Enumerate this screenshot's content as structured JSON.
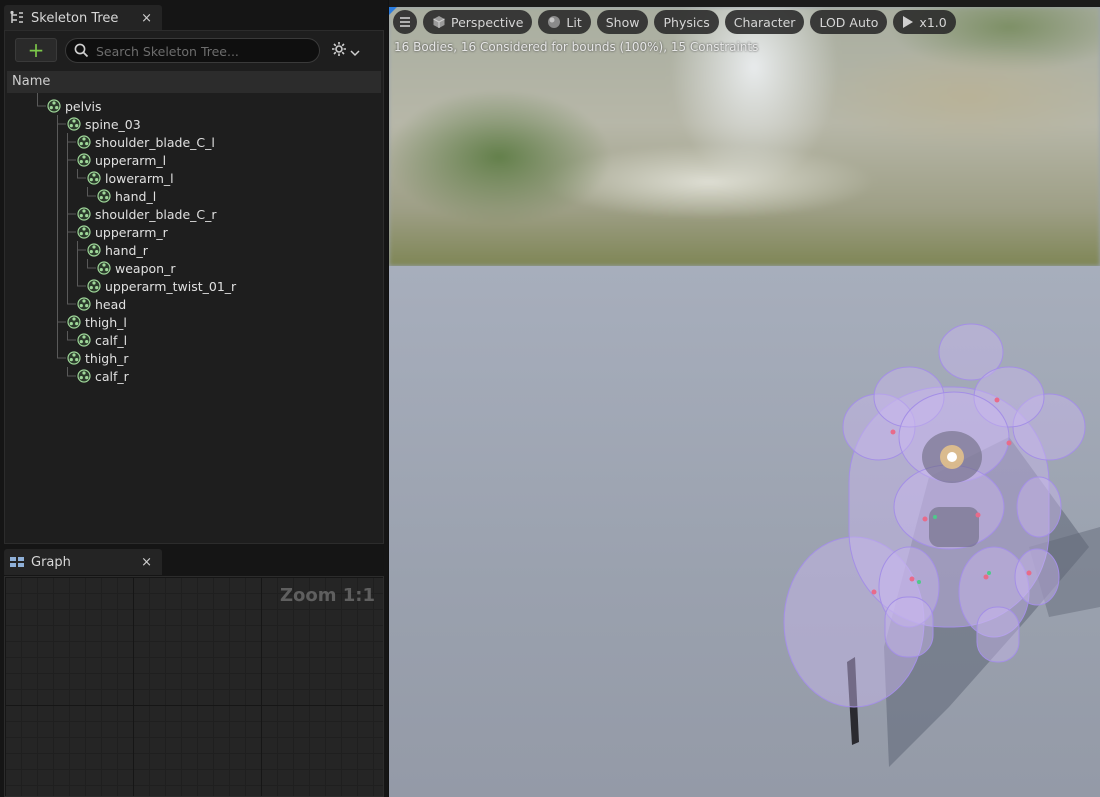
{
  "skeleton_panel": {
    "tab_title": "Skeleton Tree",
    "close_glyph": "×",
    "add_glyph": "+",
    "search_placeholder": "Search Skeleton Tree...",
    "column_header": "Name",
    "bones": [
      {
        "name": "pelvis",
        "depth": 0
      },
      {
        "name": "spine_03",
        "depth": 1
      },
      {
        "name": "shoulder_blade_C_l",
        "depth": 2
      },
      {
        "name": "upperarm_l",
        "depth": 2
      },
      {
        "name": "lowerarm_l",
        "depth": 3
      },
      {
        "name": "hand_l",
        "depth": 4
      },
      {
        "name": "shoulder_blade_C_r",
        "depth": 2
      },
      {
        "name": "upperarm_r",
        "depth": 2
      },
      {
        "name": "hand_r",
        "depth": 3
      },
      {
        "name": "weapon_r",
        "depth": 4
      },
      {
        "name": "upperarm_twist_01_r",
        "depth": 3
      },
      {
        "name": "head",
        "depth": 2
      },
      {
        "name": "thigh_l",
        "depth": 1
      },
      {
        "name": "calf_l",
        "depth": 2
      },
      {
        "name": "thigh_r",
        "depth": 1
      },
      {
        "name": "calf_r",
        "depth": 2
      }
    ]
  },
  "graph_panel": {
    "tab_title": "Graph",
    "close_glyph": "×",
    "zoom_label": "Zoom 1:1"
  },
  "viewport": {
    "menu_icon": "hamburger-icon",
    "buttons": {
      "perspective": "Perspective",
      "lit": "Lit",
      "show": "Show",
      "physics": "Physics",
      "character": "Character",
      "lod": "LOD Auto",
      "play_speed": "x1.0"
    },
    "stats_text": "16 Bodies, 16 Considered for bounds (100%), 15 Constraints"
  },
  "colors": {
    "accent_green": "#7cc94a",
    "bone_icon": "#9fd89a",
    "physics_body": "#c9b8f0"
  }
}
